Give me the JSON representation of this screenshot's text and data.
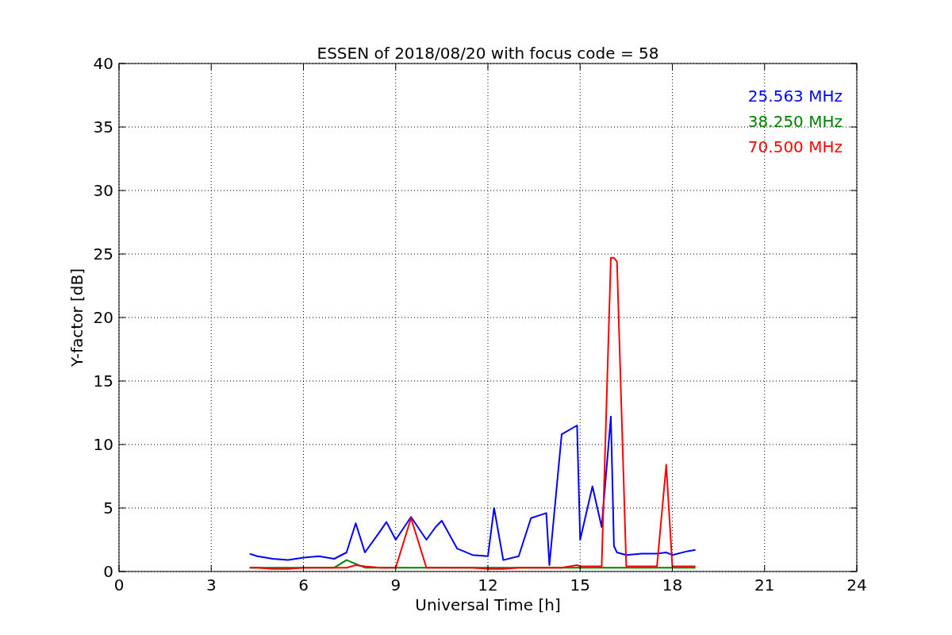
{
  "chart_data": {
    "type": "line",
    "title": "ESSEN of 2018/08/20 with focus code = 58",
    "xlabel": "Universal Time [h]",
    "ylabel": "Y-factor [dB]",
    "x": [
      4.25,
      4.5,
      5,
      5.5,
      6,
      6.5,
      7,
      7.4,
      7.7,
      8,
      8.5,
      8.7,
      9,
      9.5,
      10,
      10.3,
      10.5,
      11,
      11.5,
      12,
      12.2,
      12.5,
      13,
      13.4,
      13.9,
      14,
      14.4,
      14.9,
      15,
      15.4,
      15.7,
      16,
      16.1,
      16.2,
      16.5,
      17,
      17.5,
      17.8,
      18,
      18.5,
      18.75
    ],
    "series": [
      {
        "name": "25.563 MHz",
        "color": "#0000ff",
        "values": [
          1.4,
          1.2,
          1.0,
          0.9,
          1.1,
          1.2,
          1.0,
          1.5,
          3.8,
          1.5,
          3.2,
          3.9,
          2.5,
          4.3,
          2.5,
          3.5,
          4.0,
          1.8,
          1.3,
          1.2,
          5.0,
          0.9,
          1.2,
          4.2,
          4.6,
          0.5,
          10.8,
          11.5,
          2.5,
          6.7,
          3.5,
          12.2,
          2.0,
          1.5,
          1.3,
          1.4,
          1.4,
          1.5,
          1.3,
          1.6,
          1.7
        ]
      },
      {
        "name": "38.250 MHz",
        "color": "#008000",
        "values": [
          0.3,
          0.3,
          0.3,
          0.3,
          0.3,
          0.3,
          0.3,
          0.9,
          0.6,
          0.3,
          0.3,
          0.3,
          0.3,
          0.3,
          0.3,
          0.3,
          0.3,
          0.3,
          0.3,
          0.3,
          0.3,
          0.3,
          0.3,
          0.3,
          0.3,
          0.3,
          0.3,
          0.3,
          0.3,
          0.3,
          0.3,
          0.3,
          0.3,
          0.3,
          0.3,
          0.3,
          0.3,
          0.3,
          0.3,
          0.3,
          0.3
        ]
      },
      {
        "name": "70.500 MHz",
        "color": "#ff0000",
        "values": [
          0.3,
          0.3,
          0.2,
          0.2,
          0.3,
          0.3,
          0.3,
          0.3,
          0.5,
          0.4,
          0.3,
          0.3,
          0.3,
          4.2,
          0.3,
          0.3,
          0.3,
          0.3,
          0.3,
          0.2,
          0.2,
          0.2,
          0.3,
          0.3,
          0.3,
          0.3,
          0.3,
          0.5,
          0.4,
          0.4,
          0.4,
          24.7,
          24.7,
          24.4,
          0.4,
          0.4,
          0.4,
          8.4,
          0.4,
          0.4,
          0.4
        ]
      }
    ],
    "grid": true,
    "xlim": [
      0,
      24
    ],
    "ylim": [
      0,
      40
    ],
    "xticks": [
      0,
      3,
      6,
      9,
      12,
      15,
      18,
      21,
      24
    ],
    "yticks": [
      0,
      5,
      10,
      15,
      20,
      25,
      30,
      35,
      40
    ]
  }
}
